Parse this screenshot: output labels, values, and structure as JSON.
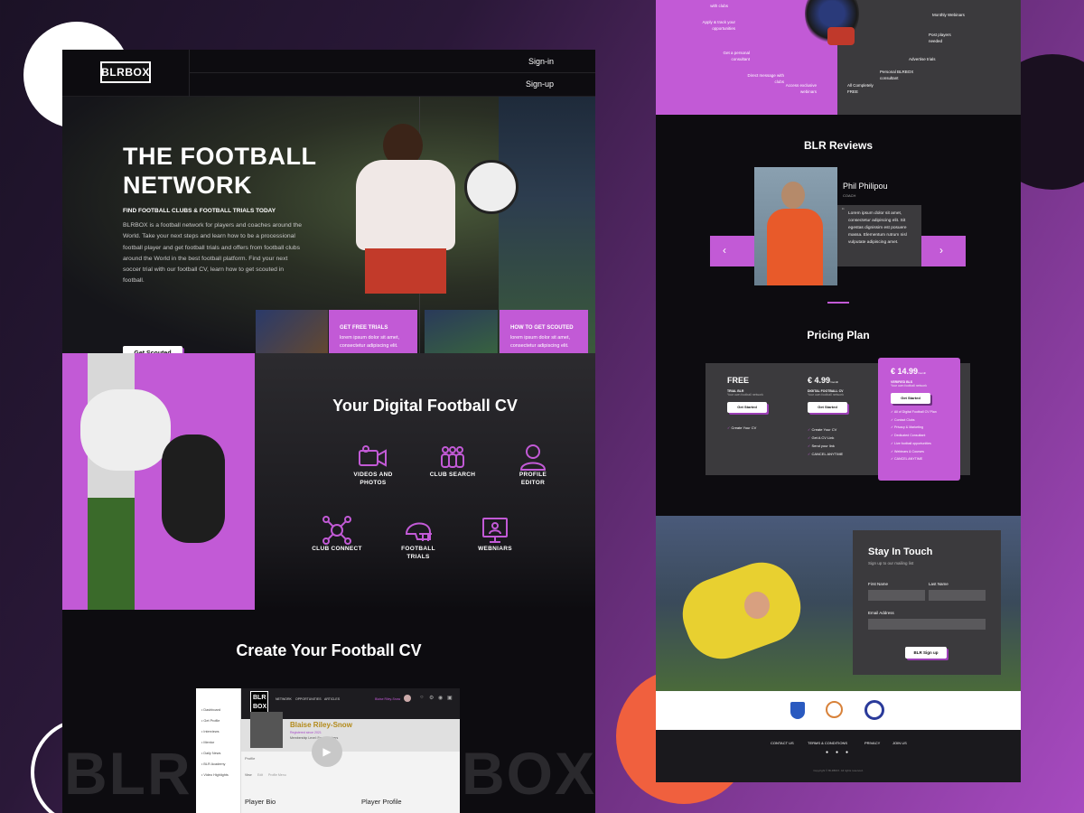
{
  "brand": {
    "logo": "BLRBOX",
    "watermark_left": "BLRB",
    "watermark_right": "BOX"
  },
  "nav": {
    "signin": "Sign-in",
    "signup": "Sign-up"
  },
  "hero": {
    "title_line1": "THE FOOTBALL",
    "title_line2": "NETWORK",
    "subtitle": "FIND FOOTBALL CLUBS & FOOTBALL TRIALS TODAY",
    "body": "BLRBOX is a football network for players and coaches around the World. Take your next steps and learn how to be a processional football player and get football trials and offers from football clubs around the World in the best football platform. Find your next soccer trial with our football CV, learn how to get scouted in football.",
    "cta": "Get Scouted"
  },
  "promo_cards": [
    {
      "title": "GET FREE TRIALS",
      "text": "lorem ipsum dolor sit amet, consectetur adipiscing elit."
    },
    {
      "title": "HOW TO GET SCOUTED",
      "text": "lorem ipsum dolor sit amet, consectetur adipiscing elit."
    }
  ],
  "digital_cv": {
    "heading": "Your Digital Football CV",
    "features": [
      {
        "label": "VIDEOS AND PHOTOS",
        "icon": "video-camera-icon"
      },
      {
        "label": "CLUB SEARCH",
        "icon": "group-icon"
      },
      {
        "label": "PROFILE EDITOR",
        "icon": "user-icon"
      },
      {
        "label": "CLUB CONNECT",
        "icon": "network-icon"
      },
      {
        "label": "FOOTBALL TRIALS",
        "icon": "helmet-icon"
      },
      {
        "label": "WEBNIARS",
        "icon": "presentation-icon"
      }
    ]
  },
  "create_cv": {
    "heading": "Create Your Football CV"
  },
  "dashboard": {
    "logo": "BLR BOX",
    "tabs": [
      "NETWORK",
      "OPPORTUNITIES",
      "ARTICLES"
    ],
    "user": "Blaise Riley-Snow",
    "sidebar": [
      "Dashboard",
      "Get Profile",
      "Interviews",
      "Mentor",
      "Daily News",
      "BLR Academy",
      "Video Highlights"
    ],
    "player_name": "Blaise Riley-Snow",
    "player_sub": "Registered since 2021",
    "player_sub2": "Membership Level: Free Members",
    "profile_label": "Profile",
    "profile_tabs": [
      "View",
      "Edit",
      "Profile Menu"
    ],
    "player_bio": "Player Bio",
    "player_profile": "Player Profile"
  },
  "benefits": {
    "left": [
      "with clubs",
      "Apply & track your opportunities",
      "Get a personal consultant",
      "Direct message with clubs",
      "Access exclusive webinars"
    ],
    "right": [
      "Monthly Webinars",
      "Post players needed",
      "Advertise trials",
      "Personal BLRBOX consultant",
      "All Completely FREE"
    ]
  },
  "reviews": {
    "heading": "BLR Reviews",
    "name": "Phil Philipou",
    "role": "COACH",
    "quote": "Lorem ipsum dolor sit amet, consectetur adipiscing elit. Sit egestas dignissim est posuere massa. Elementum rutrum nisl vulputate adipiscing amet."
  },
  "pricing": {
    "heading": "Pricing Plan",
    "plans": [
      {
        "price": "FREE",
        "per": "",
        "name": "TRIAL BLR",
        "desc": "Your own football network",
        "cta": "Get Started",
        "features": [
          "Create Your CV"
        ]
      },
      {
        "price": "€ 4.99",
        "per": "/month",
        "name": "DIGITAL FOOTBALL CV",
        "desc": "Your own football network",
        "cta": "Get Started",
        "features": [
          "Create Your CV",
          "Get A CV Link",
          "Send your link",
          "CANCEL ANYTIME"
        ]
      },
      {
        "price": "€ 14.99",
        "per": "/month",
        "name": "VERIFIED BLS",
        "desc": "Your own football network",
        "cta": "Get Started",
        "features": [
          "All of Digital Football CV Plan",
          "Contact Clubs",
          "Privacy & Marketing",
          "Dedicated Consultant",
          "Live football opportunities",
          "Webinars & Courses",
          "CANCEL ANYTIME"
        ]
      }
    ]
  },
  "contact": {
    "heading": "Stay In Touch",
    "sub": "Sign up to our mailing list",
    "first": "First Name",
    "last": "Last Name",
    "email": "Email Address",
    "cta": "BLR Sign up"
  },
  "footer": {
    "links": [
      "CONTACT US",
      "TERMS & CONDITIONS",
      "PRIVACY",
      "JOIN US"
    ],
    "copyright": "Copyright © BLRBOX. All rights reserved."
  },
  "colors": {
    "accent": "#c25ad6",
    "dark": "#0d0c10",
    "panel": "#3b3a3d"
  }
}
